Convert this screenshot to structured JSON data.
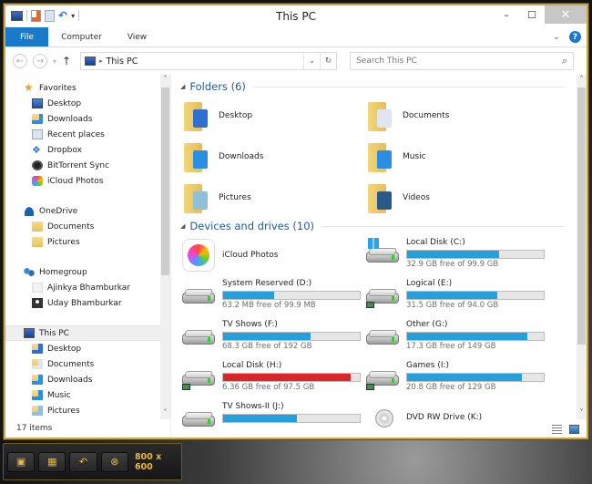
{
  "window": {
    "title": "This PC",
    "controls": {
      "minimize": "–",
      "maximize": "☐",
      "close": "✕"
    }
  },
  "quick_access_toolbar": {
    "icons": [
      "computer-icon",
      "properties-icon",
      "new-folder-icon",
      "undo-icon",
      "customize-dropdown-icon"
    ]
  },
  "ribbon": {
    "tabs": [
      {
        "label": "File",
        "active": true
      },
      {
        "label": "Computer"
      },
      {
        "label": "View"
      }
    ],
    "expand_glyph": "⌄",
    "help_glyph": "?"
  },
  "address_bar": {
    "back_glyph": "←",
    "forward_glyph": "→",
    "recent_glyph": "▾",
    "up_glyph": "↑",
    "separator_glyph": "▸",
    "path": "This PC",
    "dropdown_glyph": "⌄",
    "refresh_glyph": "↻",
    "search_placeholder": "Search This PC",
    "search_glyph": "⌕"
  },
  "navigation": {
    "favorites": {
      "label": "Favorites",
      "items": [
        "Desktop",
        "Downloads",
        "Recent places",
        "Dropbox",
        "BitTorrent Sync",
        "iCloud Photos"
      ]
    },
    "onedrive": {
      "label": "OneDrive",
      "items": [
        "Documents",
        "Pictures"
      ]
    },
    "homegroup": {
      "label": "Homegroup",
      "items": [
        "Ajinkya Bhamburkar",
        "Uday Bhamburkar"
      ]
    },
    "this_pc": {
      "label": "This PC",
      "items": [
        "Desktop",
        "Documents",
        "Downloads",
        "Music",
        "Pictures"
      ]
    },
    "scroll_up": "˄",
    "scroll_down": "˅"
  },
  "status": {
    "item_count": "17 items"
  },
  "content": {
    "folders": {
      "header": "Folders (6)",
      "items": [
        {
          "name": "Desktop",
          "icon": "desktop",
          "accent": "#2f6fd0"
        },
        {
          "name": "Documents",
          "icon": "documents",
          "accent": "#dfe6ee"
        },
        {
          "name": "Downloads",
          "icon": "downloads",
          "accent": "#2a8fe0"
        },
        {
          "name": "Music",
          "icon": "music",
          "accent": "#2a8fe0"
        },
        {
          "name": "Pictures",
          "icon": "pictures",
          "accent": "#8fc0d8"
        },
        {
          "name": "Videos",
          "icon": "videos",
          "accent": "#2a5a8a"
        }
      ]
    },
    "devices": {
      "header": "Devices and drives (10)",
      "items": [
        {
          "name": "iCloud Photos",
          "type": "app"
        },
        {
          "name": "Local Disk (C:)",
          "free": "32.9 GB free of 99.9 GB",
          "used_fraction": 0.67,
          "status": "normal",
          "badge": "windows"
        },
        {
          "name": "System Reserved (D:)",
          "free": "63.2 MB free of 99.9 MB",
          "used_fraction": 0.37,
          "status": "normal"
        },
        {
          "name": "Logical (E:)",
          "free": "31.5 GB free of 94.0 GB",
          "used_fraction": 0.66,
          "status": "normal",
          "badge": "shared"
        },
        {
          "name": "TV Shows (F:)",
          "free": "68.3 GB free of 192 GB",
          "used_fraction": 0.64,
          "status": "normal"
        },
        {
          "name": "Other (G:)",
          "free": "17.3 GB free of 149 GB",
          "used_fraction": 0.88,
          "status": "normal"
        },
        {
          "name": "Local Disk (H:)",
          "free": "6.36 GB free of 97.5 GB",
          "used_fraction": 0.93,
          "status": "critical",
          "badge": "shared"
        },
        {
          "name": "Games (I:)",
          "free": "20.8 GB free of 129 GB",
          "used_fraction": 0.84,
          "status": "normal",
          "badge": "shared"
        },
        {
          "name": "TV Shows-II (J:)",
          "free": "",
          "used_fraction": 0.54,
          "status": "normal"
        },
        {
          "name": "DVD RW Drive (K:)",
          "type": "optical"
        }
      ]
    },
    "scroll_up": "˄",
    "scroll_down": "˅"
  },
  "colors": {
    "accent": "#1979ca",
    "bar_normal": "#26a0da",
    "bar_critical": "#da2626",
    "group_header": "#1e5a9c",
    "frame_gold": "#c9a64a"
  },
  "capture_toolbar": {
    "buttons": [
      "fullscreen-capture-icon",
      "video-capture-icon",
      "undo-icon",
      "cancel-icon"
    ],
    "glyphs": [
      "▣",
      "▦",
      "↶",
      "⊗"
    ],
    "resolution": "800 x 600"
  }
}
